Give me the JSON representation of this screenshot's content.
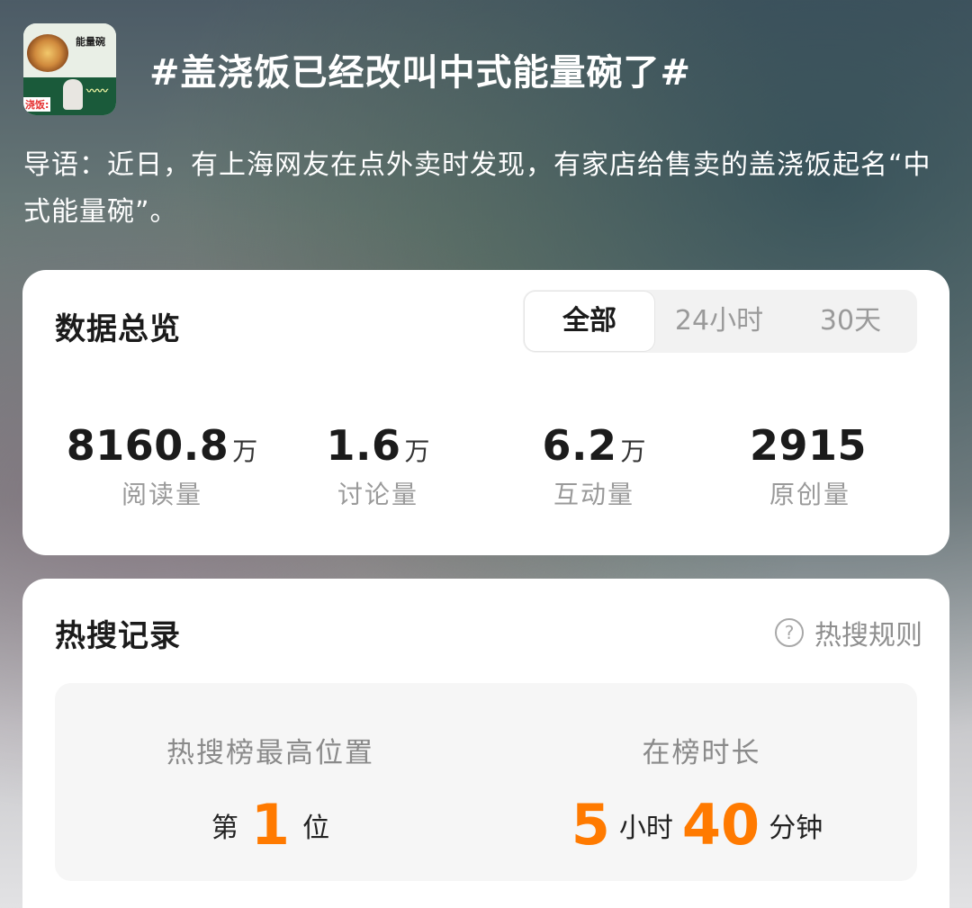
{
  "topic": {
    "thumbnail_label": "能量碗",
    "thumbnail_red_text": "浇饭:",
    "title": "#盖浇饭已经改叫中式能量碗了#",
    "intro": "导语：近日，有上海网友在点外卖时发现，有家店给售卖的盖浇饭起名“中式能量碗”。"
  },
  "overview": {
    "title": "数据总览",
    "tabs": [
      {
        "label": "全部",
        "active": true
      },
      {
        "label": "24小时",
        "active": false
      },
      {
        "label": "30天",
        "active": false
      }
    ],
    "stats": [
      {
        "value": "8160.8",
        "unit": "万",
        "label": "阅读量"
      },
      {
        "value": "1.6",
        "unit": "万",
        "label": "讨论量"
      },
      {
        "value": "6.2",
        "unit": "万",
        "label": "互动量"
      },
      {
        "value": "2915",
        "unit": "",
        "label": "原创量"
      }
    ]
  },
  "hot_search": {
    "title": "热搜记录",
    "rules_label": "热搜规则",
    "rules_icon": "question-circle-icon",
    "peak": {
      "label": "热搜榜最高位置",
      "prefix": "第",
      "value": "1",
      "suffix": "位"
    },
    "duration": {
      "label": "在榜时长",
      "hours": "5",
      "hours_unit": "小时",
      "minutes": "40",
      "minutes_unit": "分钟"
    },
    "accent_color": "#ff7a00"
  }
}
